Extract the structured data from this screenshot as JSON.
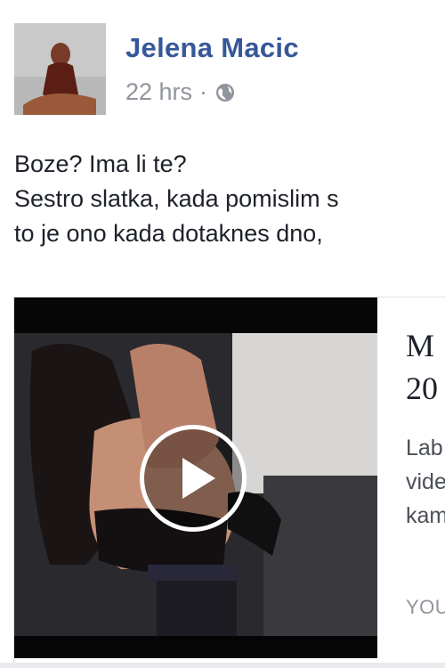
{
  "post": {
    "author": "Jelena Macic",
    "time": "22 hrs",
    "separator": "·",
    "privacy_icon": "globe-icon",
    "text_lines": [
      "Boze? Ima li te?",
      "Sestro slatka, kada pomislim s",
      "to je ono kada dotaknes dno,"
    ]
  },
  "link_card": {
    "title_lines": [
      "M",
      "20"
    ],
    "desc_lines": [
      "Lab",
      "vide",
      "kam"
    ],
    "domain": "YOU",
    "play_icon": "play-icon"
  },
  "colors": {
    "author": "#365899",
    "meta": "#90949c",
    "text": "#1d2129"
  }
}
